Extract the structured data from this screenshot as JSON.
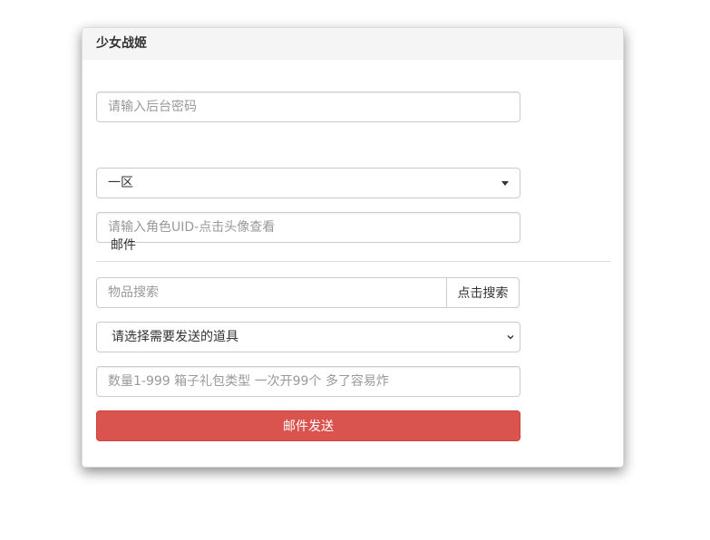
{
  "panel": {
    "title": "少女战姬"
  },
  "form": {
    "password_placeholder": "请输入后台密码",
    "server_selected": "一区",
    "uid_placeholder": "请输入角色UID-点击头像查看"
  },
  "mail_tab": {
    "label": "邮件"
  },
  "item_search": {
    "placeholder": "物品搜索",
    "button_label": "点击搜索"
  },
  "item_select": {
    "selected": "请选择需要发送的道具"
  },
  "quantity": {
    "placeholder": "数量1-999 箱子礼包类型 一次开99个 多了容易炸"
  },
  "send": {
    "label": "邮件发送"
  },
  "colors": {
    "primary_danger": "#d9534f",
    "heading_bg": "#f5f5f5",
    "border": "#cccccc"
  }
}
